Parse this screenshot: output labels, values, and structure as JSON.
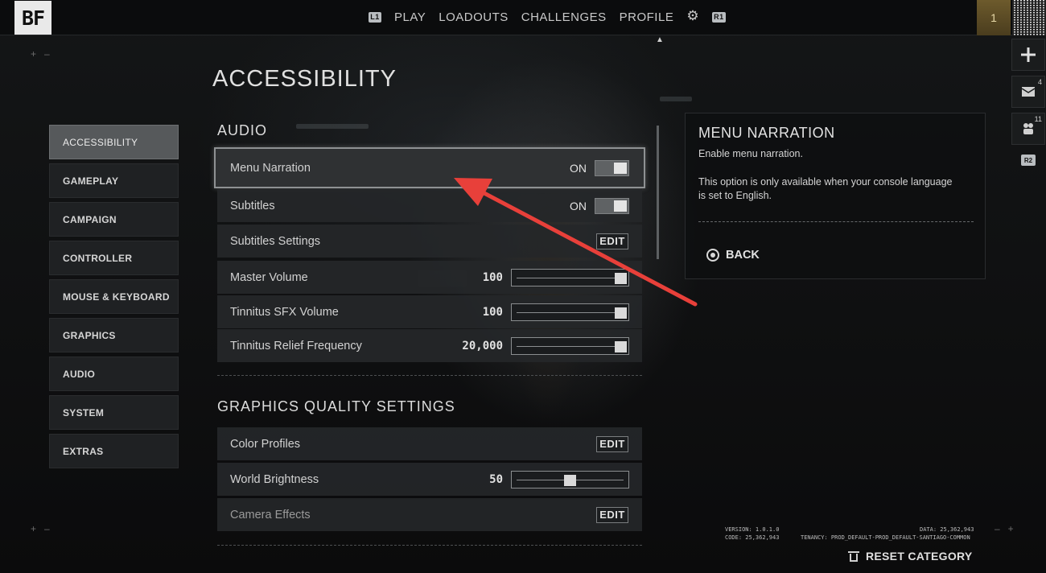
{
  "header": {
    "logo": "BF",
    "left_hint": "L1",
    "nav": [
      "PLAY",
      "LOADOUTS",
      "CHALLENGES",
      "PROFILE"
    ],
    "right_hint": "R1",
    "rank": "1"
  },
  "rail": {
    "mail_count": "4",
    "squad_count": "11",
    "hint": "R2"
  },
  "page_title": "ACCESSIBILITY",
  "categories": [
    "ACCESSIBILITY",
    "GAMEPLAY",
    "CAMPAIGN",
    "CONTROLLER",
    "MOUSE & KEYBOARD",
    "GRAPHICS",
    "AUDIO",
    "SYSTEM",
    "EXTRAS"
  ],
  "sections": {
    "audio": {
      "title": "AUDIO",
      "menu_narration": {
        "label": "Menu Narration",
        "value": "ON"
      },
      "subtitles": {
        "label": "Subtitles",
        "value": "ON"
      },
      "subtitles_settings": {
        "label": "Subtitles Settings",
        "action": "EDIT"
      },
      "master_volume": {
        "label": "Master Volume",
        "value": "100",
        "level": 1.0
      },
      "tinnitus_sfx": {
        "label": "Tinnitus SFX Volume",
        "value": "100",
        "level": 1.0
      },
      "tinnitus_relief": {
        "label": "Tinnitus Relief Frequency",
        "value": "20,000",
        "level": 1.0
      }
    },
    "graphics": {
      "title": "GRAPHICS QUALITY SETTINGS",
      "color_profiles": {
        "label": "Color Profiles",
        "action": "EDIT"
      },
      "world_brightness": {
        "label": "World Brightness",
        "value": "50",
        "level": 0.5
      },
      "camera_effects": {
        "label": "Camera Effects",
        "action": "EDIT"
      }
    }
  },
  "detail": {
    "title": "MENU NARRATION",
    "line1": "Enable menu narration.",
    "line2": "This option is only available when your console language is set to English.",
    "back": "BACK"
  },
  "footer": {
    "version": "VERSION: 1.0.1.0",
    "code": "CODE: 25,362,943",
    "data": "DATA: 25,362,943",
    "tenancy": "TENANCY: PROD_DEFAULT-PROD_DEFAULT-SANTIAGO-COMMON",
    "reset": "RESET CATEGORY"
  },
  "colors": {
    "annotation_arrow": "#e8403a",
    "rank_badge": "#6d5a2c"
  }
}
